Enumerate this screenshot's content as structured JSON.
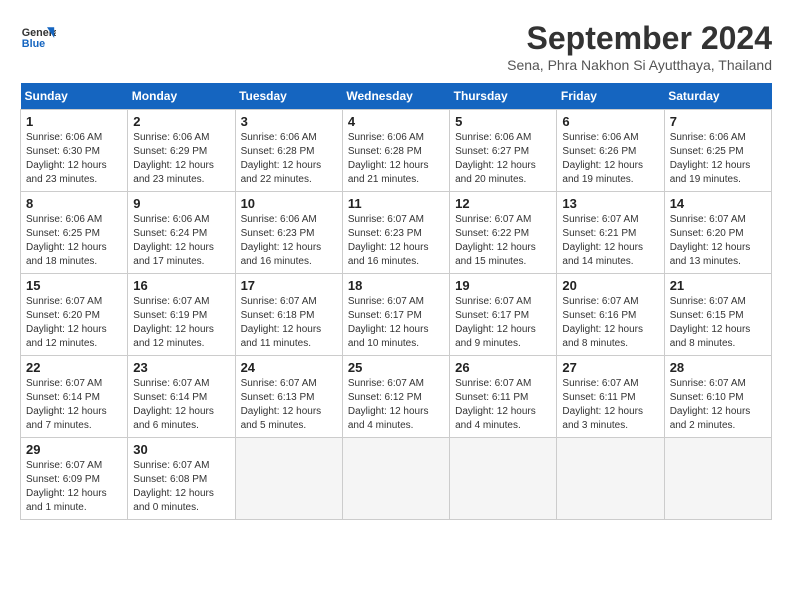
{
  "header": {
    "logo_line1": "General",
    "logo_line2": "Blue",
    "month": "September 2024",
    "location": "Sena, Phra Nakhon Si Ayutthaya, Thailand"
  },
  "days_of_week": [
    "Sunday",
    "Monday",
    "Tuesday",
    "Wednesday",
    "Thursday",
    "Friday",
    "Saturday"
  ],
  "weeks": [
    [
      {
        "day": "1",
        "sunrise": "6:06 AM",
        "sunset": "6:30 PM",
        "daylight": "12 hours and 23 minutes."
      },
      {
        "day": "2",
        "sunrise": "6:06 AM",
        "sunset": "6:29 PM",
        "daylight": "12 hours and 23 minutes."
      },
      {
        "day": "3",
        "sunrise": "6:06 AM",
        "sunset": "6:28 PM",
        "daylight": "12 hours and 22 minutes."
      },
      {
        "day": "4",
        "sunrise": "6:06 AM",
        "sunset": "6:28 PM",
        "daylight": "12 hours and 21 minutes."
      },
      {
        "day": "5",
        "sunrise": "6:06 AM",
        "sunset": "6:27 PM",
        "daylight": "12 hours and 20 minutes."
      },
      {
        "day": "6",
        "sunrise": "6:06 AM",
        "sunset": "6:26 PM",
        "daylight": "12 hours and 19 minutes."
      },
      {
        "day": "7",
        "sunrise": "6:06 AM",
        "sunset": "6:25 PM",
        "daylight": "12 hours and 19 minutes."
      }
    ],
    [
      {
        "day": "8",
        "sunrise": "6:06 AM",
        "sunset": "6:25 PM",
        "daylight": "12 hours and 18 minutes."
      },
      {
        "day": "9",
        "sunrise": "6:06 AM",
        "sunset": "6:24 PM",
        "daylight": "12 hours and 17 minutes."
      },
      {
        "day": "10",
        "sunrise": "6:06 AM",
        "sunset": "6:23 PM",
        "daylight": "12 hours and 16 minutes."
      },
      {
        "day": "11",
        "sunrise": "6:07 AM",
        "sunset": "6:23 PM",
        "daylight": "12 hours and 16 minutes."
      },
      {
        "day": "12",
        "sunrise": "6:07 AM",
        "sunset": "6:22 PM",
        "daylight": "12 hours and 15 minutes."
      },
      {
        "day": "13",
        "sunrise": "6:07 AM",
        "sunset": "6:21 PM",
        "daylight": "12 hours and 14 minutes."
      },
      {
        "day": "14",
        "sunrise": "6:07 AM",
        "sunset": "6:20 PM",
        "daylight": "12 hours and 13 minutes."
      }
    ],
    [
      {
        "day": "15",
        "sunrise": "6:07 AM",
        "sunset": "6:20 PM",
        "daylight": "12 hours and 12 minutes."
      },
      {
        "day": "16",
        "sunrise": "6:07 AM",
        "sunset": "6:19 PM",
        "daylight": "12 hours and 12 minutes."
      },
      {
        "day": "17",
        "sunrise": "6:07 AM",
        "sunset": "6:18 PM",
        "daylight": "12 hours and 11 minutes."
      },
      {
        "day": "18",
        "sunrise": "6:07 AM",
        "sunset": "6:17 PM",
        "daylight": "12 hours and 10 minutes."
      },
      {
        "day": "19",
        "sunrise": "6:07 AM",
        "sunset": "6:17 PM",
        "daylight": "12 hours and 9 minutes."
      },
      {
        "day": "20",
        "sunrise": "6:07 AM",
        "sunset": "6:16 PM",
        "daylight": "12 hours and 8 minutes."
      },
      {
        "day": "21",
        "sunrise": "6:07 AM",
        "sunset": "6:15 PM",
        "daylight": "12 hours and 8 minutes."
      }
    ],
    [
      {
        "day": "22",
        "sunrise": "6:07 AM",
        "sunset": "6:14 PM",
        "daylight": "12 hours and 7 minutes."
      },
      {
        "day": "23",
        "sunrise": "6:07 AM",
        "sunset": "6:14 PM",
        "daylight": "12 hours and 6 minutes."
      },
      {
        "day": "24",
        "sunrise": "6:07 AM",
        "sunset": "6:13 PM",
        "daylight": "12 hours and 5 minutes."
      },
      {
        "day": "25",
        "sunrise": "6:07 AM",
        "sunset": "6:12 PM",
        "daylight": "12 hours and 4 minutes."
      },
      {
        "day": "26",
        "sunrise": "6:07 AM",
        "sunset": "6:11 PM",
        "daylight": "12 hours and 4 minutes."
      },
      {
        "day": "27",
        "sunrise": "6:07 AM",
        "sunset": "6:11 PM",
        "daylight": "12 hours and 3 minutes."
      },
      {
        "day": "28",
        "sunrise": "6:07 AM",
        "sunset": "6:10 PM",
        "daylight": "12 hours and 2 minutes."
      }
    ],
    [
      {
        "day": "29",
        "sunrise": "6:07 AM",
        "sunset": "6:09 PM",
        "daylight": "12 hours and 1 minute."
      },
      {
        "day": "30",
        "sunrise": "6:07 AM",
        "sunset": "6:08 PM",
        "daylight": "12 hours and 0 minutes."
      },
      null,
      null,
      null,
      null,
      null
    ]
  ]
}
